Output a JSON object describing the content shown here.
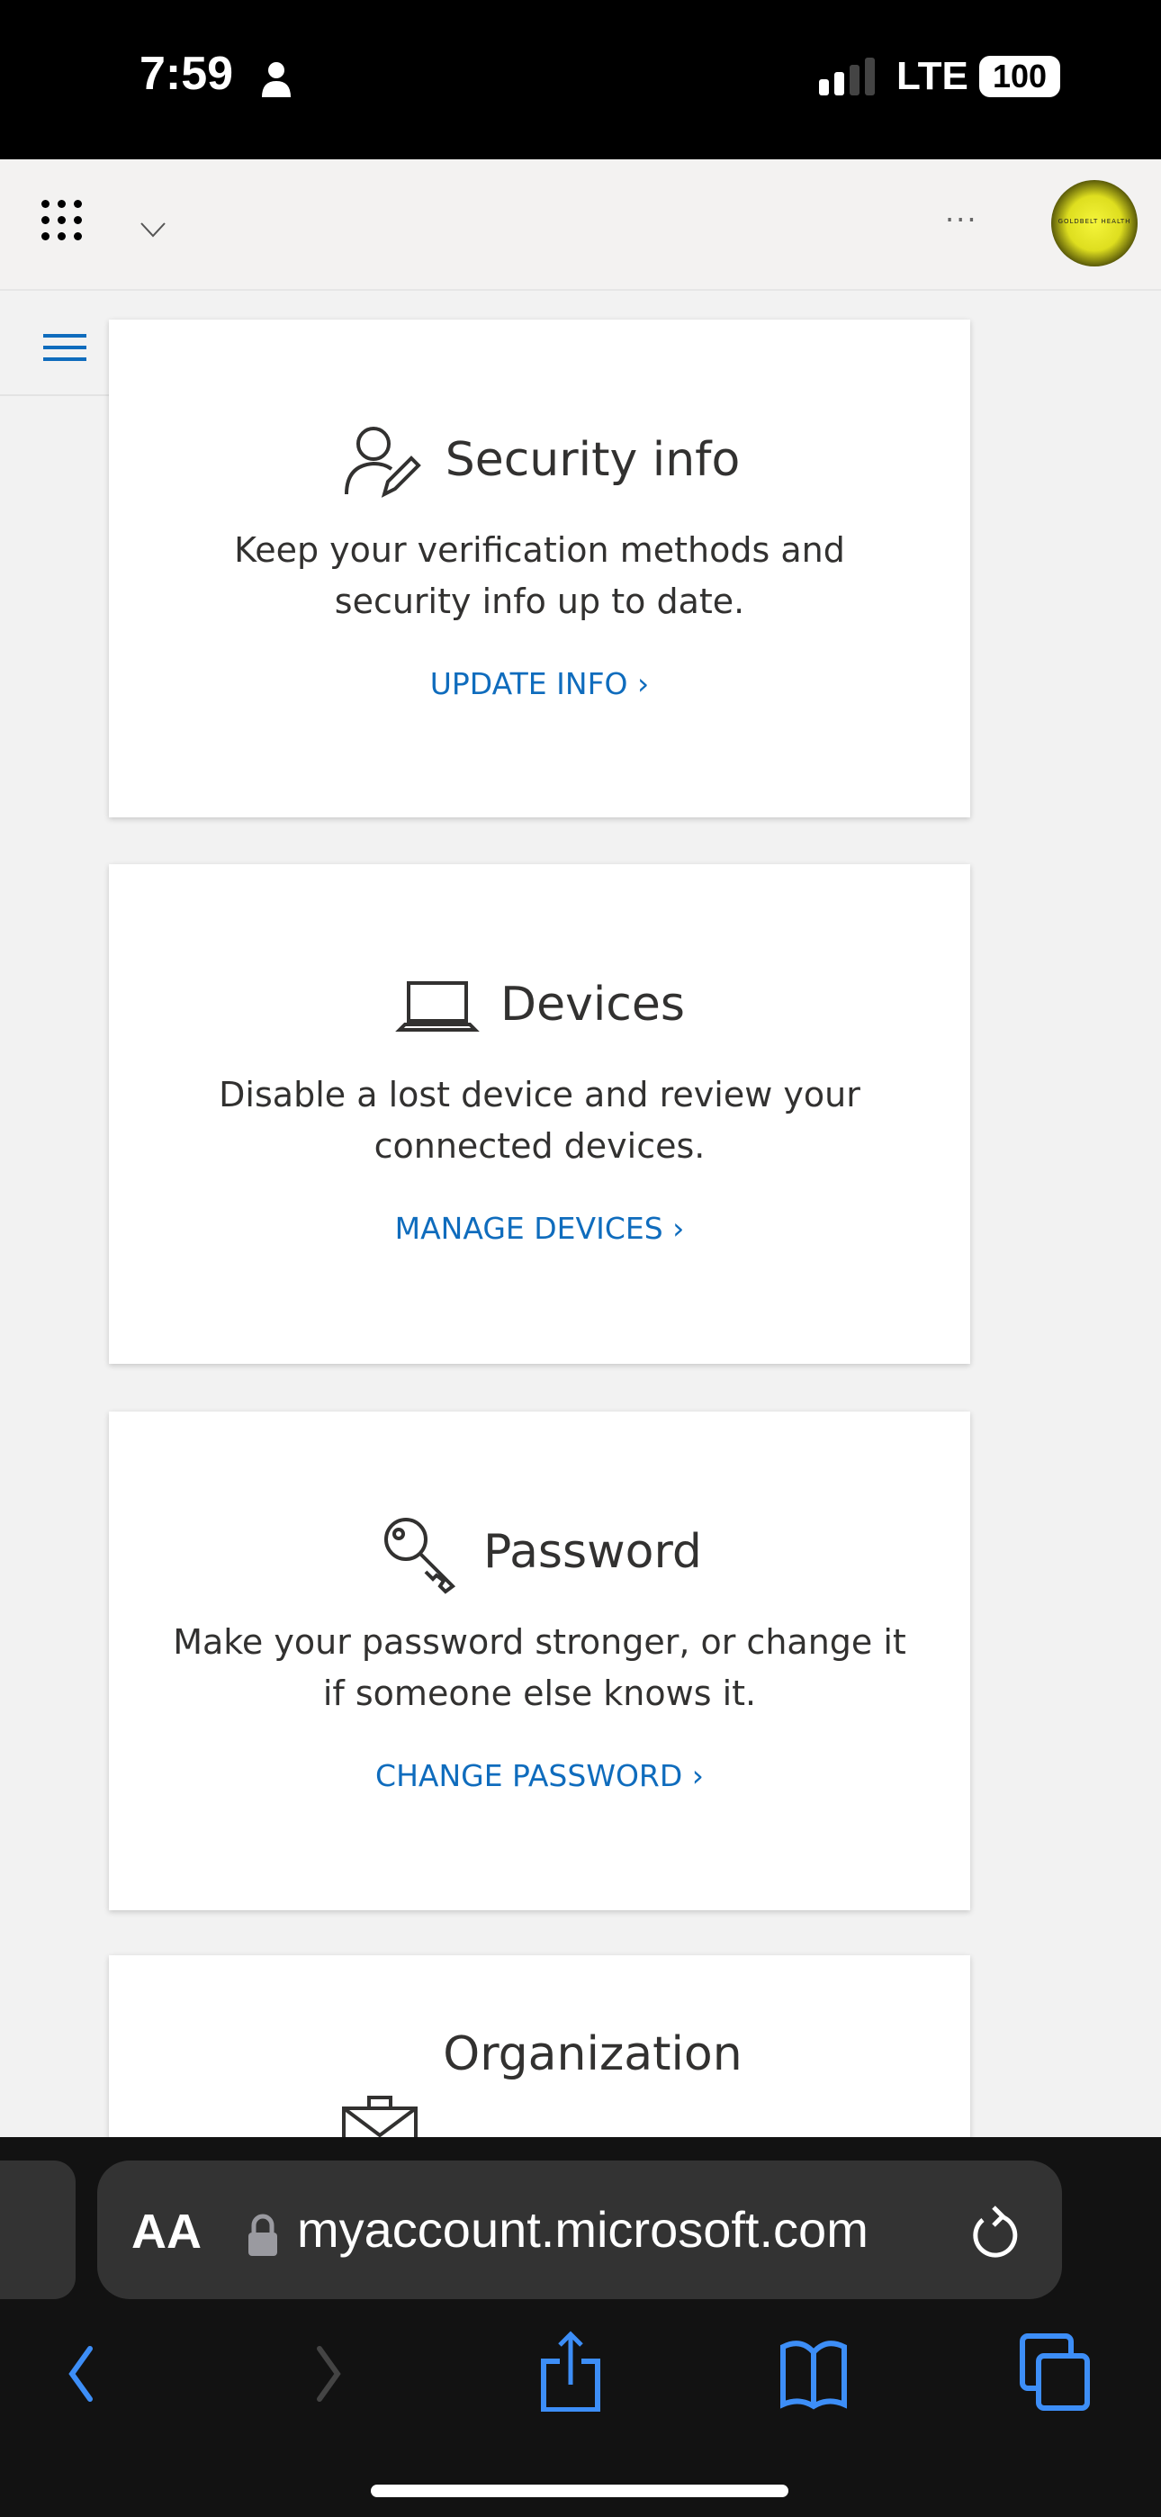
{
  "status_bar": {
    "time": "7:59",
    "network": "LTE",
    "battery": "100"
  },
  "header": {
    "avatar_text": "GOLDBELT HEALTH",
    "more_label": "···"
  },
  "cards": [
    {
      "title": "Security info",
      "description": "Keep your verification methods and security info up to date.",
      "link": "UPDATE INFO",
      "icon": "user-edit-icon"
    },
    {
      "title": "Devices",
      "description": "Disable a lost device and review your connected devices.",
      "link": "MANAGE DEVICES",
      "icon": "laptop-icon"
    },
    {
      "title": "Password",
      "description": "Make your password stronger, or change it if someone else knows it.",
      "link": "CHANGE PASSWORD",
      "icon": "key-icon"
    },
    {
      "title": "Organization",
      "icon": "briefcase-icon"
    }
  ],
  "browser": {
    "text_size_label": "AA",
    "url": "myaccount.microsoft.com"
  },
  "colors": {
    "accent": "#0f6cbd",
    "safari_blue": "#3d8ef7"
  }
}
